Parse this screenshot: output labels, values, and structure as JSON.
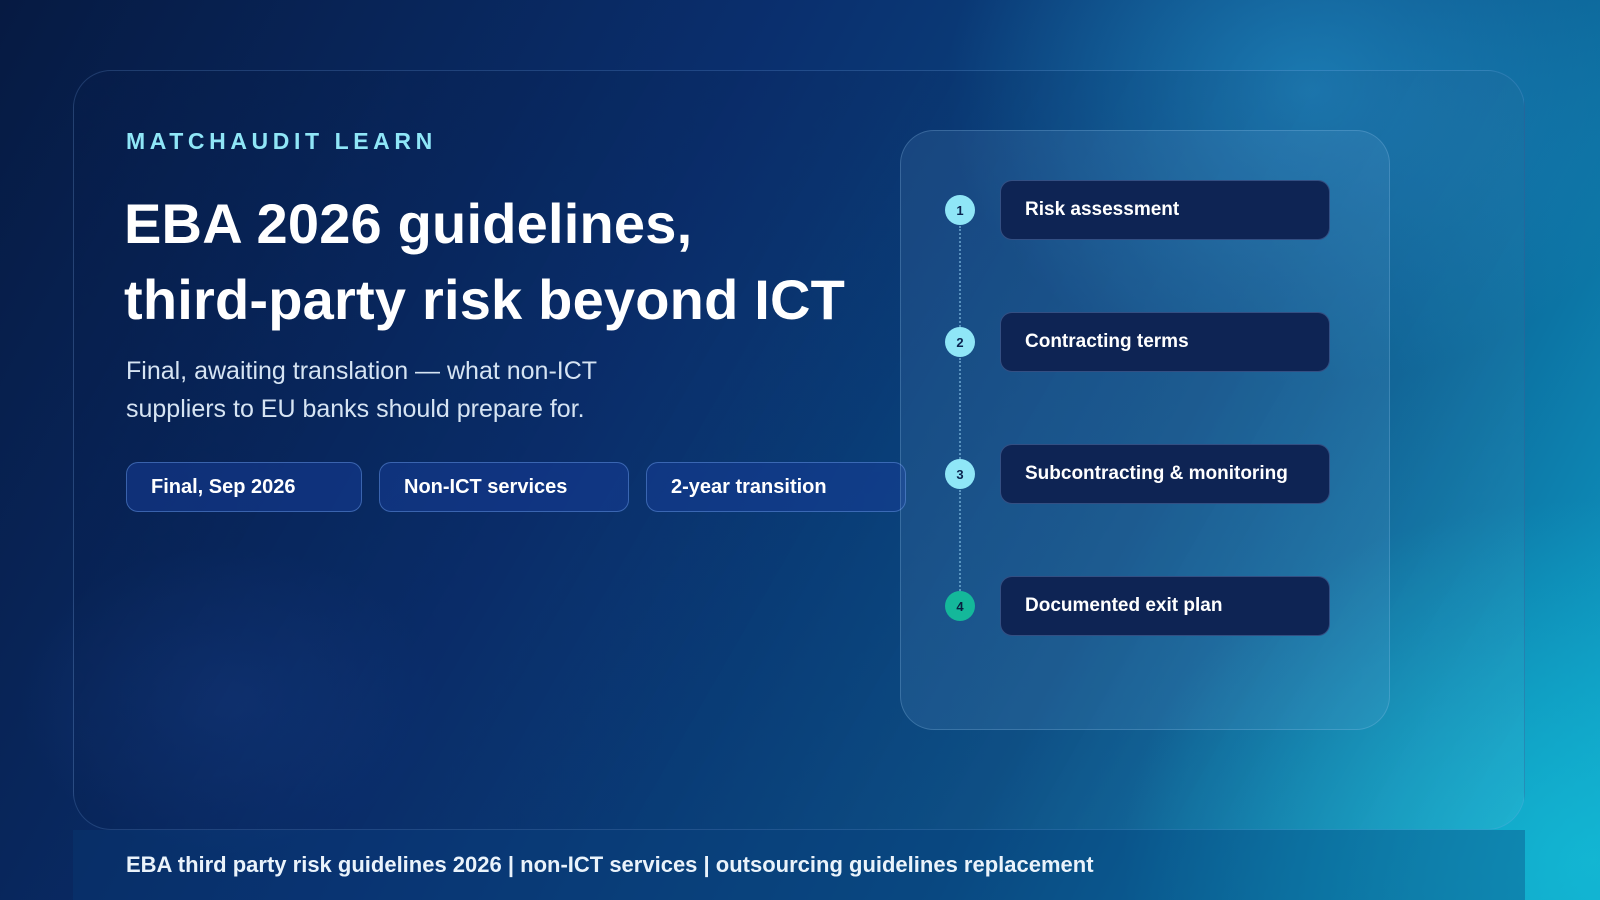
{
  "brand": "MATCHAUDIT LEARN",
  "title": {
    "line1": "EBA 2026 guidelines,",
    "line2": "third-party risk beyond ICT"
  },
  "subtitle": {
    "line1": "Final, awaiting translation — what non-ICT",
    "line2": "suppliers to EU banks should prepare for."
  },
  "tags": [
    {
      "label": "Final, Sep 2026"
    },
    {
      "label": "Non-ICT services"
    },
    {
      "label": "2-year transition"
    }
  ],
  "steps": [
    {
      "number": "1",
      "label": "Risk assessment",
      "marker_color": "#8fe6f7"
    },
    {
      "number": "2",
      "label": "Contracting terms",
      "marker_color": "#8fe6f7"
    },
    {
      "number": "3",
      "label": "Subcontracting & monitoring",
      "marker_color": "#8fe6f7"
    },
    {
      "number": "4",
      "label": "Documented exit plan",
      "marker_color": "#14b89a"
    }
  ],
  "footer": {
    "text": "EBA third party risk guidelines 2026 | non-ICT services | outsourcing guidelines replacement"
  },
  "colors": {
    "accent": "#8fe6f7",
    "final_step": "#14b89a",
    "step_box": "#0e2454"
  }
}
